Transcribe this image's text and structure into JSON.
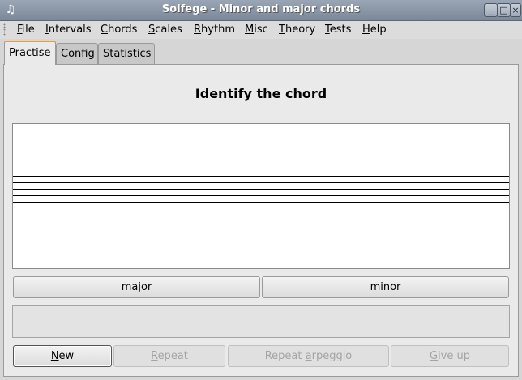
{
  "window": {
    "title": "Solfege - Minor and major chords",
    "minimize_icon": "minimize-icon",
    "maximize_icon": "maximize-icon",
    "close_icon": "close-icon"
  },
  "menubar": {
    "items": [
      {
        "ul": "F",
        "rest": "ile"
      },
      {
        "ul": "I",
        "rest": "ntervals"
      },
      {
        "ul": "C",
        "rest": "hords"
      },
      {
        "ul": "S",
        "rest": "cales"
      },
      {
        "ul": "R",
        "rest": "hythm"
      },
      {
        "ul": "M",
        "rest": "isc"
      },
      {
        "ul": "T",
        "rest": "heory"
      },
      {
        "ul": "T",
        "rest": "ests"
      },
      {
        "ul": "H",
        "rest": "elp"
      }
    ]
  },
  "tabs": [
    {
      "label": "Practise",
      "active": true
    },
    {
      "label": "Config",
      "active": false
    },
    {
      "label": "Statistics",
      "active": false
    }
  ],
  "exercise": {
    "heading": "Identify the chord",
    "answers": [
      "major",
      "minor"
    ],
    "feedback_text": ""
  },
  "actions": {
    "new": {
      "ul": "N",
      "rest": "ew",
      "enabled": true
    },
    "repeat": {
      "ul": "R",
      "rest": "epeat",
      "enabled": false
    },
    "repeat_arpeggio": {
      "pre": "Repeat ",
      "ul": "a",
      "rest": "rpeggio",
      "enabled": false
    },
    "give_up": {
      "ul": "G",
      "rest": "ive up",
      "enabled": false
    }
  }
}
